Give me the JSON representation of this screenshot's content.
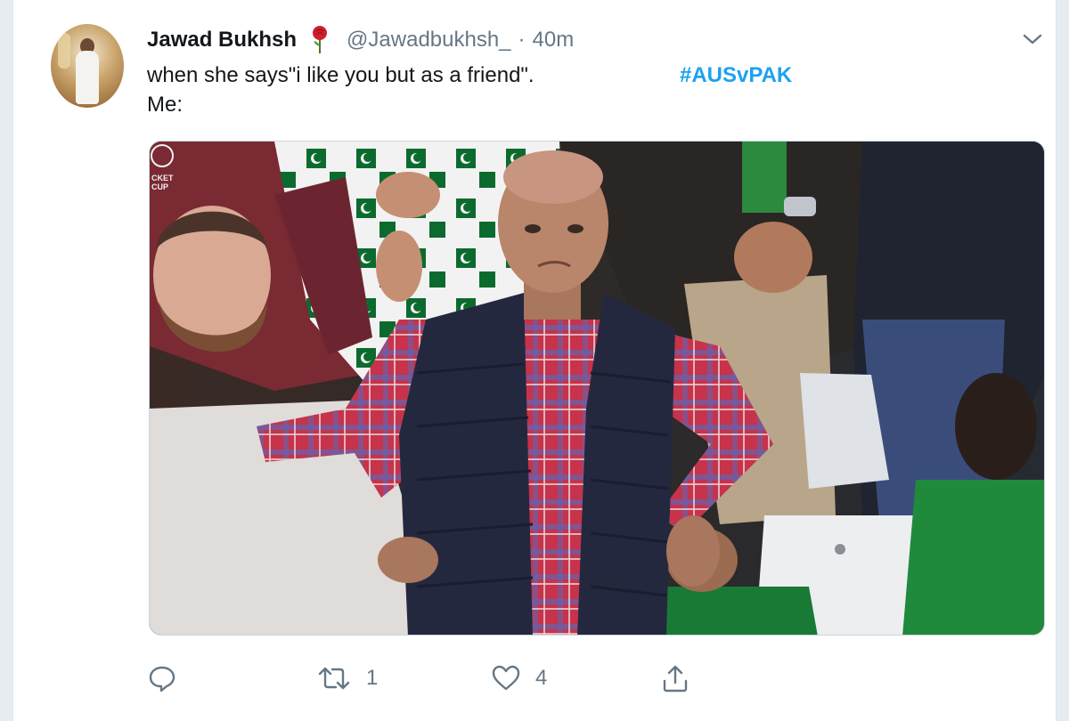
{
  "tweet": {
    "display_name": "Jawad Bukhsh",
    "handle": "@Jawadbukhsh_",
    "separator": "·",
    "time": "40m",
    "text_line1": "when she says\"i like you but as a friend\".",
    "text_line2": "Me:",
    "hashtag": "#AUSvPAK"
  },
  "media": {
    "corner_text": "CKET\nCUP",
    "alt": "Photo"
  },
  "actions": {
    "reply_count": "",
    "retweet_count": "1",
    "like_count": "4"
  },
  "icons": {
    "rose": "rose-emoji-icon",
    "caret": "chevron-down-icon",
    "reply": "reply-icon",
    "retweet": "retweet-icon",
    "like": "heart-icon",
    "share": "share-icon"
  },
  "colors": {
    "link": "#1da1f2",
    "muted": "#657786",
    "text": "#14171a"
  }
}
